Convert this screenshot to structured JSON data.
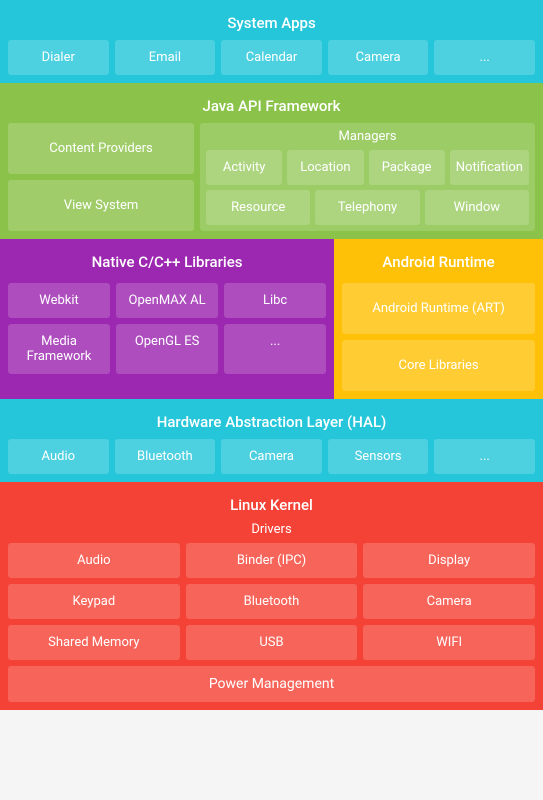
{
  "systemApps": {
    "title": "System Apps",
    "items": [
      "Dialer",
      "Email",
      "Calendar",
      "Camera",
      "..."
    ]
  },
  "javaApi": {
    "title": "Java API Framework",
    "leftItems": [
      "Content Providers",
      "View System"
    ],
    "managers": {
      "title": "Managers",
      "row1": [
        "Activity",
        "Location",
        "Package",
        "Notification"
      ],
      "row2": [
        "Resource",
        "Telephony",
        "Window"
      ]
    }
  },
  "nativeLibs": {
    "title": "Native C/C++ Libraries",
    "items": [
      "Webkit",
      "OpenMAX AL",
      "Libc",
      "Media Framework",
      "OpenGL ES",
      "..."
    ]
  },
  "androidRuntime": {
    "title": "Android Runtime",
    "items": [
      "Android Runtime (ART)",
      "Core Libraries"
    ]
  },
  "hal": {
    "title": "Hardware Abstraction Layer (HAL)",
    "items": [
      "Audio",
      "Bluetooth",
      "Camera",
      "Sensors",
      "..."
    ]
  },
  "linuxKernel": {
    "title": "Linux Kernel",
    "drivers": {
      "title": "Drivers",
      "items": [
        "Audio",
        "Binder (IPC)",
        "Display",
        "Keypad",
        "Bluetooth",
        "Camera",
        "Shared Memory",
        "USB",
        "WIFI"
      ]
    },
    "powerManagement": "Power Management"
  }
}
